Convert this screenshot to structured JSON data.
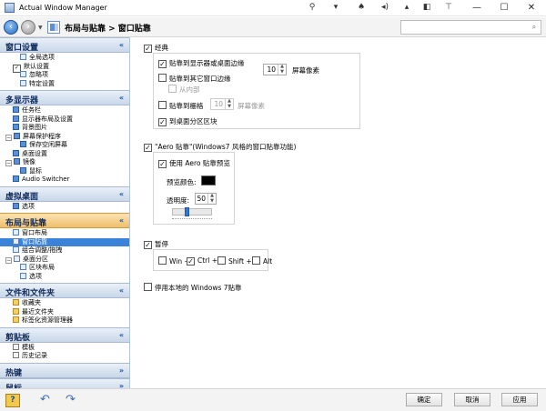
{
  "window": {
    "title": "Actual Window Manager",
    "icons": {
      "back": "arrow-left-icon",
      "forward": "arrow-right-icon"
    }
  },
  "titlebar_tools": [
    "pin-icon",
    "chevron-down-icon",
    "spade-icon",
    "speaker-icon",
    "rollup-icon",
    "transparency-icon",
    "on-top-icon"
  ],
  "navbar": {
    "breadcrumb": "布局与贴靠 > 窗口贴靠",
    "search_value": "",
    "search_icon": "search-icon"
  },
  "sidebar": {
    "groups": [
      {
        "label": "窗口设置",
        "chevron": "«",
        "active": false,
        "items": [
          {
            "label": "全局选项",
            "indent": 2
          },
          {
            "label": "默认设置",
            "indent": 1,
            "checkbox": true
          },
          {
            "label": "忽略项",
            "indent": 2
          },
          {
            "label": "特定设置",
            "indent": 2
          }
        ]
      },
      {
        "label": "多显示器",
        "chevron": "«",
        "active": false,
        "items": [
          {
            "label": "任务栏",
            "indent": 1
          },
          {
            "label": "显示器布局及设置",
            "indent": 1
          },
          {
            "label": "背景图片",
            "indent": 1
          },
          {
            "label": "屏幕保护程序",
            "indent": 0,
            "expander": "−"
          },
          {
            "label": "保存空闲屏幕",
            "indent": 2
          },
          {
            "label": "桌面设置",
            "indent": 1
          },
          {
            "label": "镜像",
            "indent": 0,
            "expander": "−"
          },
          {
            "label": "鼠标",
            "indent": 2
          },
          {
            "label": "Audio Switcher",
            "indent": 1
          }
        ]
      },
      {
        "label": "虚拟桌面",
        "chevron": "«",
        "active": false,
        "items": [
          {
            "label": "选项",
            "indent": 1
          }
        ]
      },
      {
        "label": "布局与贴靠",
        "chevron": "«",
        "active": true,
        "items": [
          {
            "label": "窗口布局",
            "indent": 1
          },
          {
            "label": "窗口贴靠",
            "indent": 1,
            "selected": true
          },
          {
            "label": "组合调整/拖拽",
            "indent": 1
          },
          {
            "label": "桌面分区",
            "indent": 0,
            "expander": "−"
          },
          {
            "label": "区块布局",
            "indent": 2
          },
          {
            "label": "选项",
            "indent": 2
          }
        ]
      },
      {
        "label": "文件和文件夹",
        "chevron": "«",
        "active": false,
        "items": [
          {
            "label": "收藏夹",
            "indent": 1
          },
          {
            "label": "最近文件夹",
            "indent": 1
          },
          {
            "label": "标签化资源管理器",
            "indent": 1
          }
        ]
      },
      {
        "label": "剪贴板",
        "chevron": "«",
        "active": false,
        "items": [
          {
            "label": "模板",
            "indent": 1
          },
          {
            "label": "历史记录",
            "indent": 1
          }
        ]
      },
      {
        "label": "热键",
        "chevron": "»",
        "active": false,
        "items": []
      },
      {
        "label": "鼠标",
        "chevron": "»",
        "active": false,
        "items": []
      }
    ]
  },
  "content": {
    "classic": {
      "label": "经典",
      "checked": true,
      "snap_screen_edges": {
        "label": "贴靠到显示器或桌面边缘",
        "checked": true
      },
      "snap_screen_value": "10",
      "snap_screen_unit": "屏幕像素",
      "snap_other_windows": {
        "label": "贴靠到其它窗口边缘",
        "checked": false
      },
      "from_inside": {
        "label": "从内部",
        "checked": false
      },
      "snap_grid": {
        "label": "贴靠到栅格",
        "checked": false
      },
      "grid_value": "10",
      "grid_unit": "屏幕像素",
      "snap_zones": {
        "label": "到桌面分区区块",
        "checked": true
      }
    },
    "aero": {
      "label": "\"Aero 贴靠\"(Windows7 风格的窗口贴靠功能)",
      "checked": true,
      "preview": {
        "label": "使用 Aero 贴靠预览",
        "checked": true
      },
      "preview_color_label": "预览颜色:",
      "preview_color": "#000000",
      "transparency_label": "透明度:",
      "transparency_value": "50",
      "slider_level": 0.35
    },
    "pause": {
      "label": "暂停",
      "checked": true,
      "keys": [
        {
          "label": "Win +",
          "checked": false
        },
        {
          "label": "Ctrl +",
          "checked": true
        },
        {
          "label": "Shift +",
          "checked": false
        },
        {
          "label": "Alt",
          "checked": false
        }
      ]
    },
    "disable_native": {
      "label": "停用本地的 Windows 7贴靠",
      "checked": false
    }
  },
  "bottombar": {
    "ok": "确定",
    "cancel": "取消",
    "apply": "应用",
    "icons": [
      "help-icon",
      "undo-icon",
      "redo-icon"
    ]
  }
}
